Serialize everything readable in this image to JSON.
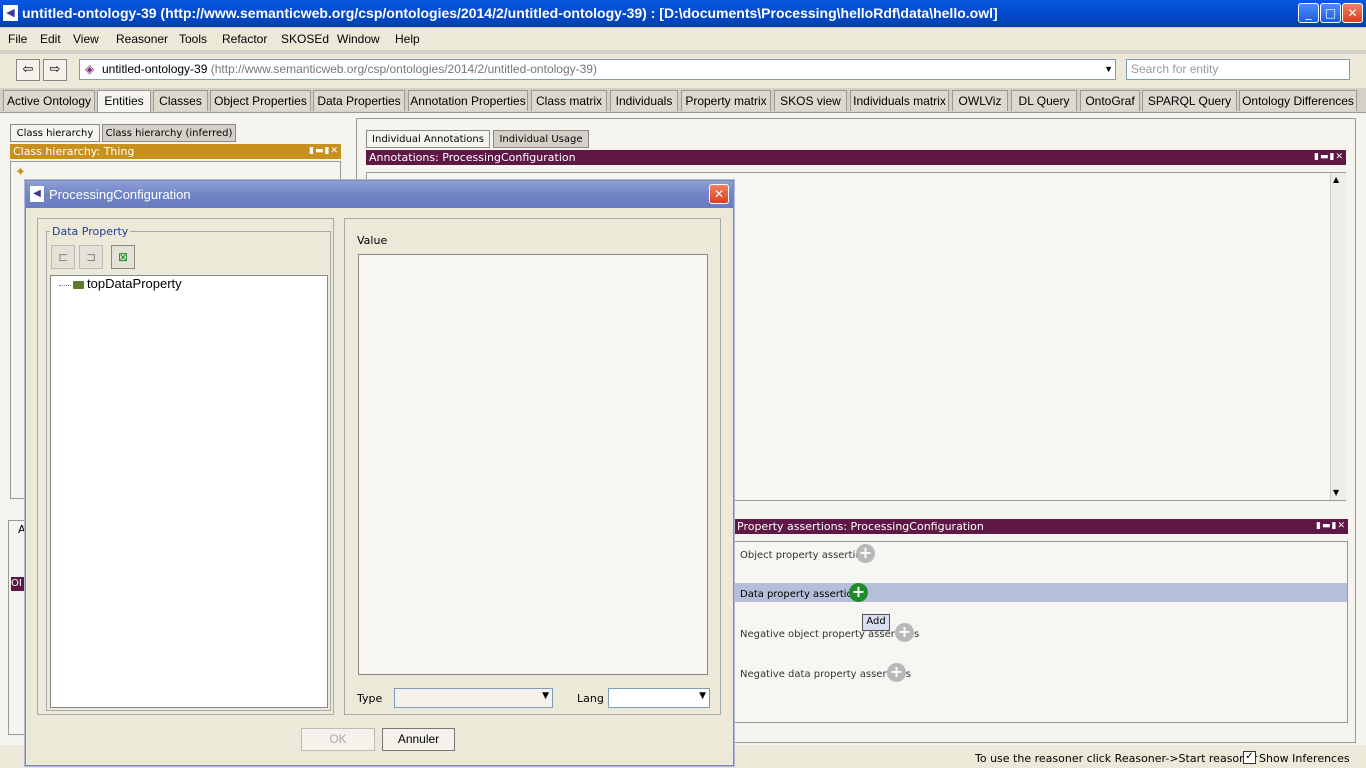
{
  "window": {
    "title": "untitled-ontology-39 (http://www.semanticweb.org/csp/ontologies/2014/2/untitled-ontology-39)  : [D:\\documents\\Processing\\helloRdf\\data\\hello.owl]",
    "minimize": "_",
    "maximize": "□",
    "close": "✕"
  },
  "menu": [
    "File",
    "Edit",
    "View",
    "Reasoner",
    "Tools",
    "Refactor",
    "SKOSEd",
    "Window",
    "Help"
  ],
  "navbar": {
    "back": "⇦",
    "forward": "⇨",
    "ontology_name": "untitled-ontology-39 ",
    "ontology_iri": "(http://www.semanticweb.org/csp/ontologies/2014/2/untitled-ontology-39)",
    "search_placeholder": "Search for entity"
  },
  "tabs": [
    {
      "label": "Active Ontology",
      "active": false
    },
    {
      "label": "Entities",
      "active": true
    },
    {
      "label": "Classes",
      "active": false
    },
    {
      "label": "Object Properties",
      "active": false
    },
    {
      "label": "Data Properties",
      "active": false
    },
    {
      "label": "Annotation Properties",
      "active": false
    },
    {
      "label": "Class matrix",
      "active": false
    },
    {
      "label": "Individuals",
      "active": false
    },
    {
      "label": "Property matrix",
      "active": false
    },
    {
      "label": "SKOS view",
      "active": false
    },
    {
      "label": "Individuals matrix",
      "active": false
    },
    {
      "label": "OWLViz",
      "active": false
    },
    {
      "label": "DL Query",
      "active": false
    },
    {
      "label": "OntoGraf",
      "active": false
    },
    {
      "label": "SPARQL Query",
      "active": false
    },
    {
      "label": "Ontology Differences",
      "active": false
    }
  ],
  "left": {
    "subtab_class_hierarchy": "Class hierarchy",
    "subtab_inferred": "Class hierarchy (inferred)",
    "view_title": "Class hierarchy: Thing",
    "lower_tab_fragment": "A",
    "lower_bar_fragment": "OI"
  },
  "right": {
    "subtab_annotations": "Individual Annotations",
    "subtab_usage": "Individual Usage",
    "annotations_title": "Annotations: ProcessingConfiguration",
    "property_title": "Property assertions: ProcessingConfiguration",
    "assertions": {
      "object": "Object property assertions",
      "data": "Data property assertions",
      "neg_object": "Negative object property assertions",
      "neg_data": "Negative data property assertions"
    },
    "tooltip": "Add"
  },
  "status": {
    "message": "To use the reasoner click Reasoner->Start reasoner",
    "show_inferences": "Show Inferences"
  },
  "dialog": {
    "title": "ProcessingConfiguration",
    "data_property_label": "Data Property",
    "tree_item": "topDataProperty",
    "value_label": "Value",
    "type_label": "Type",
    "lang_label": "Lang",
    "ok": "OK",
    "cancel": "Annuler"
  },
  "colors": {
    "titlebar": "#0a58e0",
    "viewbar_orange": "#c8901c",
    "viewbar_purple": "#5f1845",
    "highlight_row": "#b5bfd9",
    "add_green": "#1f8c2c",
    "data_property_green": "#5f7a2f"
  }
}
